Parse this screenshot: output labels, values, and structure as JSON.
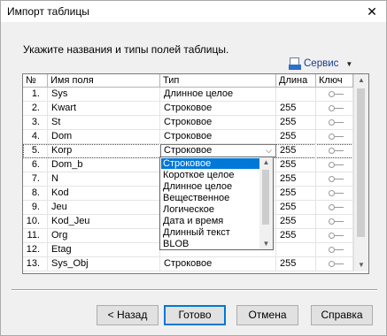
{
  "window": {
    "title": "Импорт таблицы",
    "close_glyph": "✕"
  },
  "instruction": "Укажите названия и типы полей таблицы.",
  "service_menu": {
    "label": "Сервис",
    "icon": "document-tool-icon"
  },
  "grid": {
    "columns": [
      "№",
      "Имя поля",
      "Тип",
      "Длина",
      "Ключ"
    ],
    "rows": [
      {
        "num": "1.",
        "name": "Sys",
        "type": "Длинное целое",
        "length": ""
      },
      {
        "num": "2.",
        "name": "Kwart",
        "type": "Строковое",
        "length": "255"
      },
      {
        "num": "3.",
        "name": "St",
        "type": "Строковое",
        "length": "255"
      },
      {
        "num": "4.",
        "name": "Dom",
        "type": "Строковое",
        "length": "255"
      },
      {
        "num": "5.",
        "name": "Korp",
        "type": "Строковое",
        "length": "255"
      },
      {
        "num": "6.",
        "name": "Dom_b",
        "type": "",
        "length": "255"
      },
      {
        "num": "7.",
        "name": "N",
        "type": "",
        "length": "255"
      },
      {
        "num": "8.",
        "name": "Kod",
        "type": "",
        "length": "255"
      },
      {
        "num": "9.",
        "name": "Jeu",
        "type": "",
        "length": "255"
      },
      {
        "num": "10.",
        "name": "Kod_Jeu",
        "type": "",
        "length": "255"
      },
      {
        "num": "11.",
        "name": "Org",
        "type": "",
        "length": "255"
      },
      {
        "num": "12.",
        "name": "Etag",
        "type": "",
        "length": ""
      },
      {
        "num": "13.",
        "name": "Sys_Obj",
        "type": "Строковое",
        "length": "255"
      }
    ],
    "current_row": 4
  },
  "type_dropdown": {
    "options": [
      "Строковое",
      "Короткое целое",
      "Длинное целое",
      "Вещественное",
      "Логическое",
      "Дата и время",
      "Длинный текст",
      "BLOB"
    ],
    "selected": "Строковое"
  },
  "buttons": {
    "back": "< Назад",
    "done": "Готово",
    "cancel": "Отмена",
    "help": "Справка"
  },
  "colors": {
    "selection": "#0078d7",
    "service_link": "#1c3b8c"
  }
}
